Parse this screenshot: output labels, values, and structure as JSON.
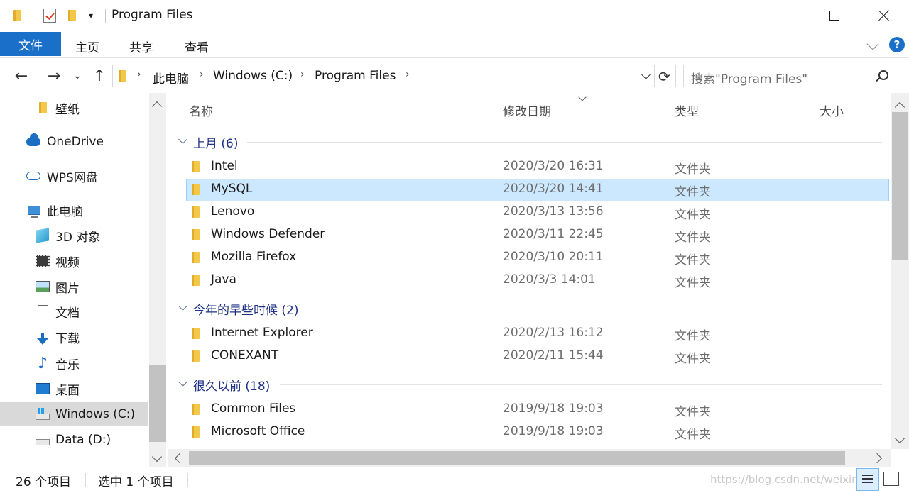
{
  "window": {
    "title": "Program Files"
  },
  "ribbon": {
    "tabs": [
      "文件",
      "主页",
      "共享",
      "查看"
    ],
    "help_label": "?"
  },
  "nav": {
    "back": "←",
    "forward": "→",
    "recent": "⌄",
    "up": "↑",
    "breadcrumbs": [
      "此电脑",
      "Windows (C:)",
      "Program Files"
    ],
    "refresh": "⟳",
    "search_placeholder": "搜索\"Program Files\""
  },
  "sidebar": {
    "items": [
      {
        "label": "壁纸",
        "icon": "folder-icon"
      },
      {
        "label": "OneDrive",
        "icon": "onedrive-icon"
      },
      {
        "label": "WPS网盘",
        "icon": "wps-cloud-icon"
      },
      {
        "label": "此电脑",
        "icon": "pc-icon"
      },
      {
        "label": "3D 对象",
        "icon": "3d-objects-icon"
      },
      {
        "label": "视频",
        "icon": "video-icon"
      },
      {
        "label": "图片",
        "icon": "pictures-icon"
      },
      {
        "label": "文档",
        "icon": "documents-icon"
      },
      {
        "label": "下载",
        "icon": "download-icon"
      },
      {
        "label": "音乐",
        "icon": "music-icon"
      },
      {
        "label": "桌面",
        "icon": "desktop-icon"
      },
      {
        "label": "Windows (C:)",
        "icon": "drive-c-icon"
      },
      {
        "label": "Data (D:)",
        "icon": "drive-d-icon"
      }
    ]
  },
  "columns": [
    "名称",
    "修改日期",
    "类型",
    "大小"
  ],
  "groups": [
    {
      "label": "上月 (6)",
      "rows": [
        {
          "name": "Intel",
          "date": "2020/3/20 16:31",
          "type": "文件夹"
        },
        {
          "name": "MySQL",
          "date": "2020/3/20 14:41",
          "type": "文件夹"
        },
        {
          "name": "Lenovo",
          "date": "2020/3/13 13:56",
          "type": "文件夹"
        },
        {
          "name": "Windows Defender",
          "date": "2020/3/11 22:45",
          "type": "文件夹"
        },
        {
          "name": "Mozilla Firefox",
          "date": "2020/3/10 20:11",
          "type": "文件夹"
        },
        {
          "name": "Java",
          "date": "2020/3/3 14:01",
          "type": "文件夹"
        }
      ]
    },
    {
      "label": "今年的早些时候 (2)",
      "rows": [
        {
          "name": "Internet Explorer",
          "date": "2020/2/13 16:12",
          "type": "文件夹"
        },
        {
          "name": "CONEXANT",
          "date": "2020/2/11 15:44",
          "type": "文件夹"
        }
      ]
    },
    {
      "label": "很久以前 (18)",
      "rows": [
        {
          "name": "Common Files",
          "date": "2019/9/18 19:03",
          "type": "文件夹"
        },
        {
          "name": "Microsoft Office",
          "date": "2019/9/18 19:03",
          "type": "文件夹"
        }
      ]
    }
  ],
  "status": {
    "item_count": "26 个项目",
    "selection": "选中 1 个项目",
    "watermark": "https://blog.csdn.net/weixin_"
  },
  "colors": {
    "accent": "#1a6fc8",
    "selection": "#cce8ff",
    "group_header": "#1e3287"
  }
}
